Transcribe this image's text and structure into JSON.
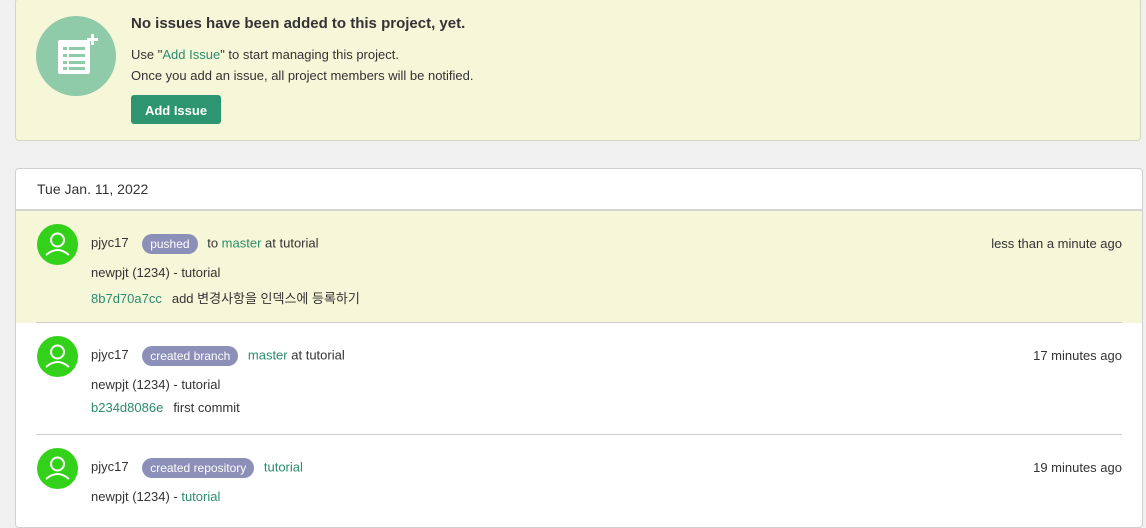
{
  "empty_state": {
    "icon": "issue-list-add-icon",
    "title": "No issues have been added to this project, yet.",
    "line1_prefix": "Use \"",
    "line1_link": "Add Issue",
    "line1_suffix": "\" to start managing this project.",
    "line2": "Once you add an issue, all project members will be notified.",
    "button_label": "Add Issue"
  },
  "activity": {
    "date": "Tue Jan. 11, 2022",
    "entries": [
      {
        "user": "pjyc17",
        "action": "pushed",
        "pre_text": "to",
        "target": "master",
        "post_text": "at tutorial",
        "time": "less than a minute ago",
        "project": "newpjt (1234) - tutorial",
        "commit_hash": "8b7d70a7cc",
        "commit_message": "add 변경사항을 인덱스에 등록하기"
      },
      {
        "user": "pjyc17",
        "action": "created branch",
        "target": "master",
        "post_text": "at tutorial",
        "time": "17 minutes ago",
        "project": "newpjt (1234) - tutorial",
        "commit_hash": "b234d8086e",
        "commit_message": "first commit"
      },
      {
        "user": "pjyc17",
        "action": "created repository",
        "target": "tutorial",
        "time": "19 minutes ago",
        "project_prefix": "newpjt (1234) - ",
        "project_link": "tutorial"
      }
    ]
  },
  "colors": {
    "accent": "#2d9670",
    "link": "#2a8c6f",
    "badge": "#8c8fb7",
    "avatar": "#33d11a",
    "highlight_bg": "#f6f6d9"
  }
}
